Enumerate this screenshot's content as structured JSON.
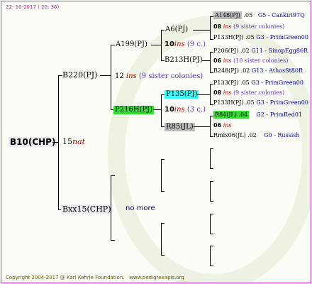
{
  "header": {
    "date": "22- 10-2017 ( 20: 36)"
  },
  "colors": {
    "border": "#cc33cc",
    "highlight_cyan": "#33ffff",
    "highlight_green": "#33dd33",
    "highlight_gray": "#bbbbbb",
    "root_bg": "#e8eaf0"
  },
  "root": {
    "label": "B10(CHP)",
    "count": "15",
    "ins": "nat"
  },
  "gen1": {
    "top": {
      "label": "B220(PJ)"
    },
    "bottom": {
      "label": "Bxx15(CHP)",
      "note": "no more"
    }
  },
  "gen2": {
    "top": {
      "label": "A199(PJ)"
    },
    "middle": {
      "count": "12",
      "ins": "ins",
      "sisters": "(9 sister colonies)"
    },
    "bottom": {
      "label": "P216H(PJ)"
    }
  },
  "gen3": {
    "a": {
      "label": "A6(PJ)"
    },
    "b": {
      "count": "10",
      "ins": "ins",
      "sisters": "(9 c.)"
    },
    "c": {
      "label": "B213H(PJ)"
    },
    "d": {
      "label": "P135(PJ)"
    },
    "e": {
      "count": "10",
      "ins": "ins",
      "sisters": "(3 c.)"
    },
    "f": {
      "label": "R85(JL)"
    }
  },
  "gen4": {
    "r1": {
      "label": "A148(PJ)",
      "year": ".05",
      "breeder": "G5 - Cankiri97Q"
    },
    "r2": {
      "count": "08",
      "ins": "ins",
      "sisters": "(9 sister colonies)"
    },
    "r3": {
      "label": "P133H(PJ)",
      "year": ".05",
      "breeder": "G3 - PrimGreen00"
    },
    "r4": {
      "label": "P206(PJ)",
      "year": ".02",
      "breeder": "G11 - SinopEgg86R"
    },
    "r5": {
      "count": "06",
      "ins": "ins",
      "sisters": "(10 sister colonies)"
    },
    "r6": {
      "label": "B248(PJ)",
      "year": ".02",
      "breeder": "G13 - AthosSt80R"
    },
    "r7": {
      "label": "P133(PJ)",
      "year": ".05",
      "breeder": "G3 - PrimGreen00"
    },
    "r8": {
      "count": "08",
      "ins": "ins",
      "sisters": "(9 sister colonies)"
    },
    "r9": {
      "label": "P133H(PJ)",
      "year": ".05",
      "breeder": "G3 - PrimGreen00"
    },
    "r10": {
      "label": "R84(JL)",
      "year": ".04",
      "breeder": "G2 - PrimRed01"
    },
    "r11": {
      "count": "06",
      "ins": "ins"
    },
    "r12": {
      "label": "Rmix06(JL)",
      "year": ".02",
      "breeder": "G0 - Russish"
    }
  },
  "footer": {
    "copyright": "Copyright 2004-2017 @ Karl Kehrle Foundation.",
    "url": "www.pedigreeapis.org"
  }
}
